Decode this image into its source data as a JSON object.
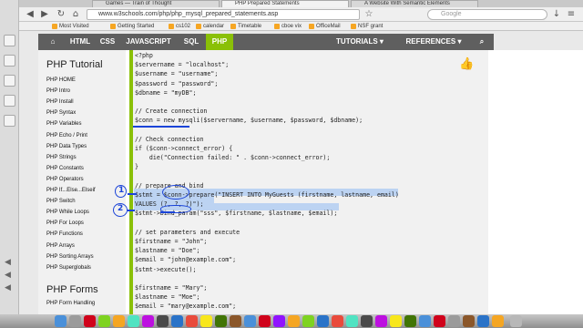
{
  "browser": {
    "tabs": [
      {
        "label": "Games — Train of Thought",
        "active": false
      },
      {
        "label": "PHP Prepared Statements",
        "active": true
      },
      {
        "label": "A Website With Semantic Elements",
        "active": false
      }
    ],
    "url": "www.w3schools.com/php/php_mysql_prepared_statements.asp",
    "search_placeholder": "Google",
    "bookmarks": [
      "Most Visited",
      "Getting Started",
      "cs102",
      "calendar",
      "Timetable",
      "cboe vix",
      "OfficeMail",
      "NSF grant"
    ]
  },
  "topnav": {
    "items": [
      "HTML",
      "CSS",
      "JAVASCRIPT",
      "SQL",
      "PHP"
    ],
    "selected": "PHP",
    "right_items": [
      "TUTORIALS",
      "REFERENCES"
    ],
    "accent": "#8ac007",
    "bar_color": "#5f5f5f"
  },
  "sidebar": {
    "heading": "PHP Tutorial",
    "items": [
      "PHP HOME",
      "PHP Intro",
      "PHP Install",
      "PHP Syntax",
      "PHP Variables",
      "PHP Echo / Print",
      "PHP Data Types",
      "PHP Strings",
      "PHP Constants",
      "PHP Operators",
      "PHP If...Else...Elseif",
      "PHP Switch",
      "PHP While Loops",
      "PHP For Loops",
      "PHP Functions",
      "PHP Arrays",
      "PHP Sorting Arrays",
      "PHP Superglobals"
    ],
    "heading2": "PHP Forms",
    "items2": [
      "PHP Form Handling"
    ]
  },
  "code_lines": [
    "<?php",
    "$servername = \"localhost\";",
    "$username = \"username\";",
    "$password = \"password\";",
    "$dbname = \"myDB\";",
    "",
    "// Create connection",
    "$conn = new mysqli($servername, $username, $password, $dbname);",
    "",
    "// Check connection",
    "if ($conn->connect_error) {",
    "    die(\"Connection failed: \" . $conn->connect_error);",
    "}",
    "",
    "// prepare and bind",
    "$stmt = $conn->prepare(\"INSERT INTO MyGuests (firstname, lastname, email)",
    "VALUES (?, ?, ?)\");",
    "$stmt->bind_param(\"sss\", $firstname, $lastname, $email);",
    "",
    "// set parameters and execute",
    "$firstname = \"John\";",
    "$lastname = \"Doe\";",
    "$email = \"john@example.com\";",
    "$stmt->execute();",
    "",
    "$firstname = \"Mary\";",
    "$lastname = \"Moe\";",
    "$email = \"mary@example.com\";"
  ],
  "annotations": {
    "marker1": "1",
    "marker2": "2",
    "ink_color": "#1b44d8"
  },
  "icons": {
    "like": "thumbs-up-icon",
    "back": "back-arrow-icon",
    "forward": "forward-arrow-icon",
    "reload": "reload-icon"
  }
}
